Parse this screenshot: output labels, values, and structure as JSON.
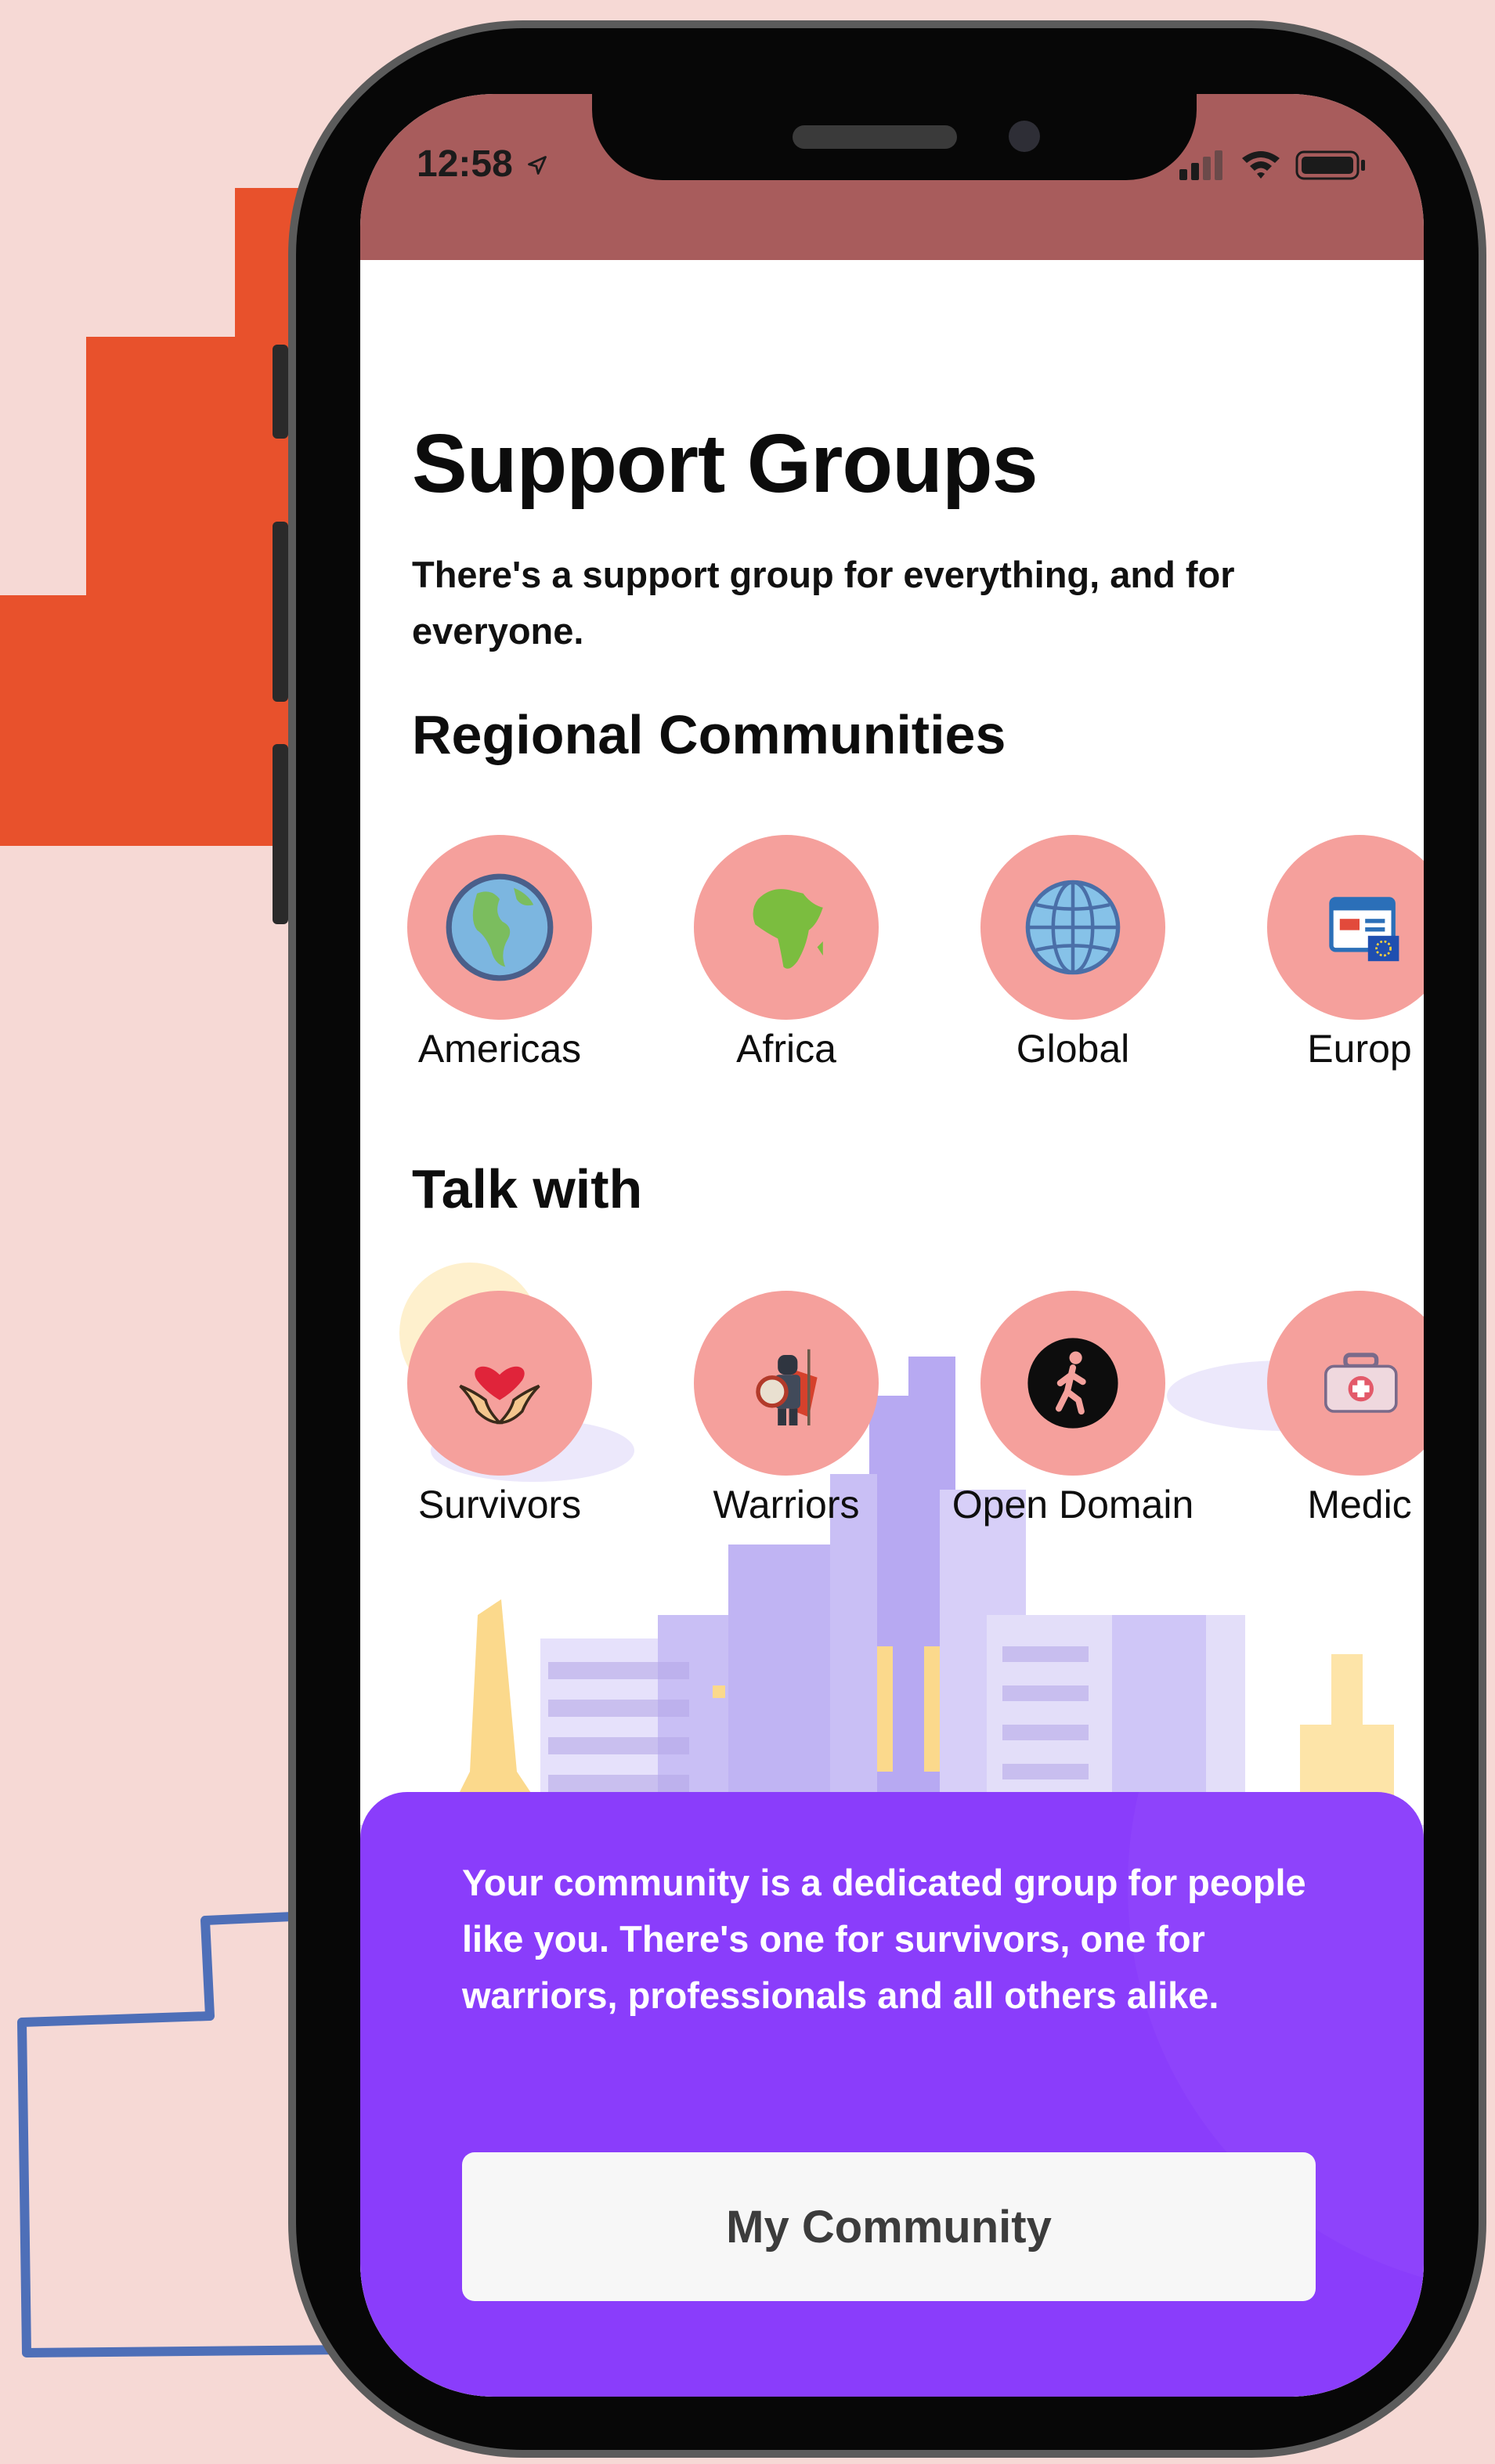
{
  "status_bar": {
    "time": "12:58",
    "icons": [
      "location-arrow-icon",
      "signal-icon",
      "wifi-icon",
      "battery-icon"
    ]
  },
  "header": {
    "title": "Support Groups",
    "subtitle": "There's a support group for everything, and for everyone."
  },
  "regional": {
    "heading": "Regional Communities",
    "items": [
      {
        "label": "Americas",
        "icon": "globe-americas-icon"
      },
      {
        "label": "Africa",
        "icon": "africa-map-icon"
      },
      {
        "label": "Global",
        "icon": "globe-grid-icon"
      },
      {
        "label": "Europ",
        "icon": "europe-flag-window-icon"
      }
    ]
  },
  "talk_with": {
    "heading": "Talk with",
    "items": [
      {
        "label": "Survivors",
        "icon": "heart-hands-icon"
      },
      {
        "label": "Warriors",
        "icon": "warrior-shield-icon"
      },
      {
        "label": "Open Domain",
        "icon": "walking-person-icon"
      },
      {
        "label": "Medic",
        "icon": "medical-kit-icon"
      }
    ]
  },
  "community_panel": {
    "text": "Your community is a dedicated group for people like you. There's one for survivors, one for warriors, professionals and all others alike.",
    "button_label": "My Community"
  },
  "colors": {
    "background": "#f6d9d5",
    "status_bar": "#a85c5c",
    "circle": "#f5a09c",
    "panel": "#8a3dfb",
    "accent_orange": "#e8512c",
    "accent_blue": "#4e6fb8"
  }
}
